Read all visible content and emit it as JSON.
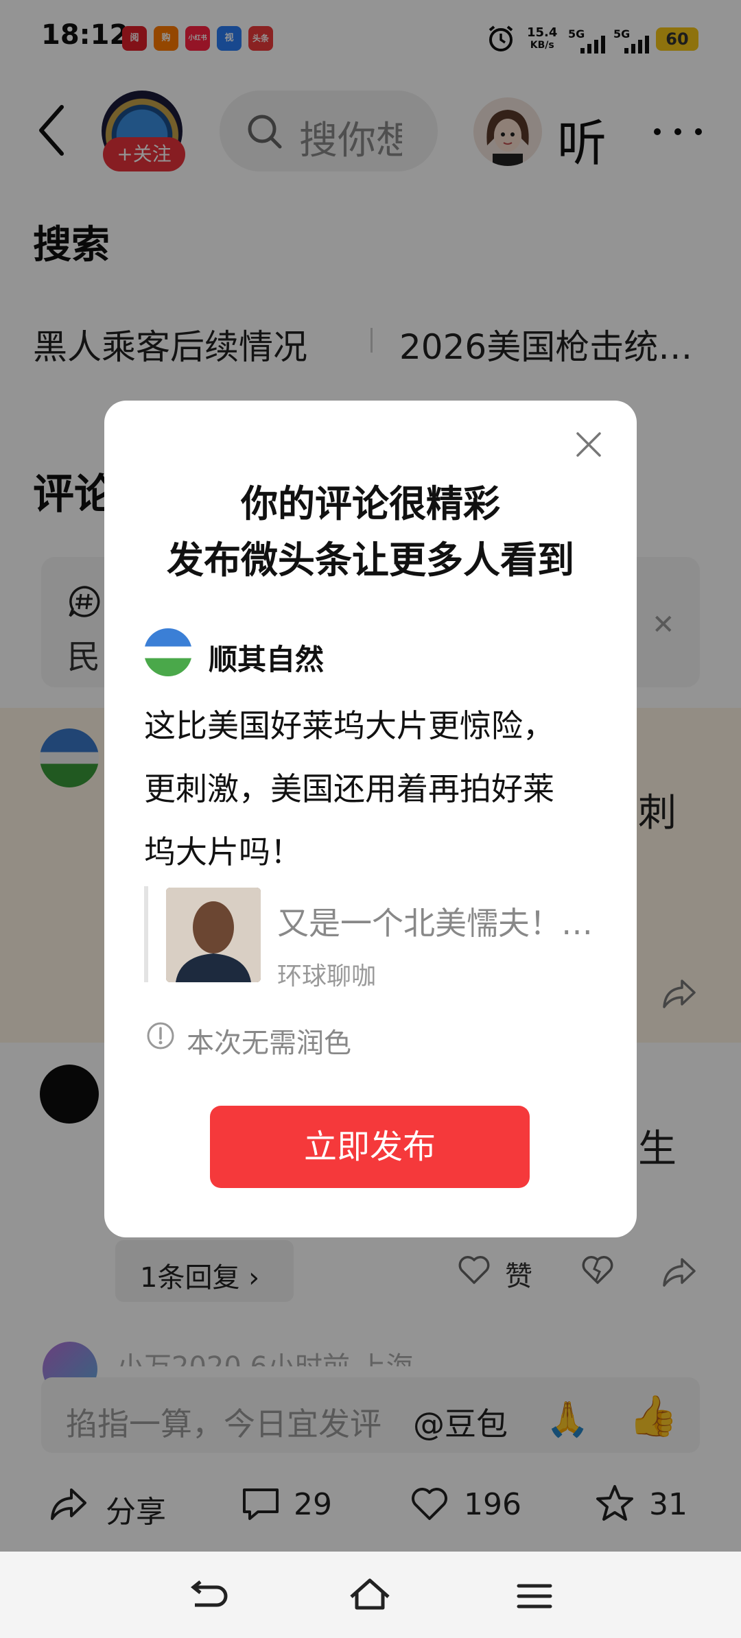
{
  "status_bar": {
    "time": "18:12",
    "net_speed": "15.4",
    "net_unit": "KB/s",
    "signal1": "5G",
    "signal2": "5G",
    "battery": "60",
    "app_icons": [
      "阅",
      "购",
      "小红书",
      "视",
      "头条"
    ]
  },
  "header": {
    "follow_label": "+关注",
    "search_placeholder": "搜你想",
    "listen_label": "听"
  },
  "search_section": {
    "title": "搜索",
    "suggestions": [
      "黑人乘客后续情况",
      "2026美国枪击统…"
    ]
  },
  "comments": {
    "heading": "评论",
    "topic_text": "民",
    "comment1_tail": "刺",
    "comment2_tail": "生",
    "reply_label": "1条回复",
    "like_label": "赞",
    "next_meta": "小万2020 6小时前 上海"
  },
  "input_bar": {
    "placeholder": "掐指一算，今日宜发评",
    "mention": "@豆包",
    "emoji1": "🙏",
    "emoji2": "👍"
  },
  "bottom_bar": {
    "share_label": "分享",
    "comment_count": "29",
    "like_count": "196",
    "favorite_count": "31"
  },
  "modal": {
    "title_line1": "你的评论很精彩",
    "title_line2": "发布微头条让更多人看到",
    "author_name": "顺其自然",
    "body_lines": [
      "这比美国好莱坞大片更惊险，",
      "更刺激，美国还用着再拍好莱",
      "坞大片吗！"
    ],
    "quote_title": "又是一个北美懦夫！…",
    "quote_source": "环球聊咖",
    "info_text": "本次无需润色",
    "publish_label": "立即发布"
  },
  "colors": {
    "accent_red": "#f5393b",
    "follow_red": "#e8333b",
    "battery": "#f5c518"
  }
}
